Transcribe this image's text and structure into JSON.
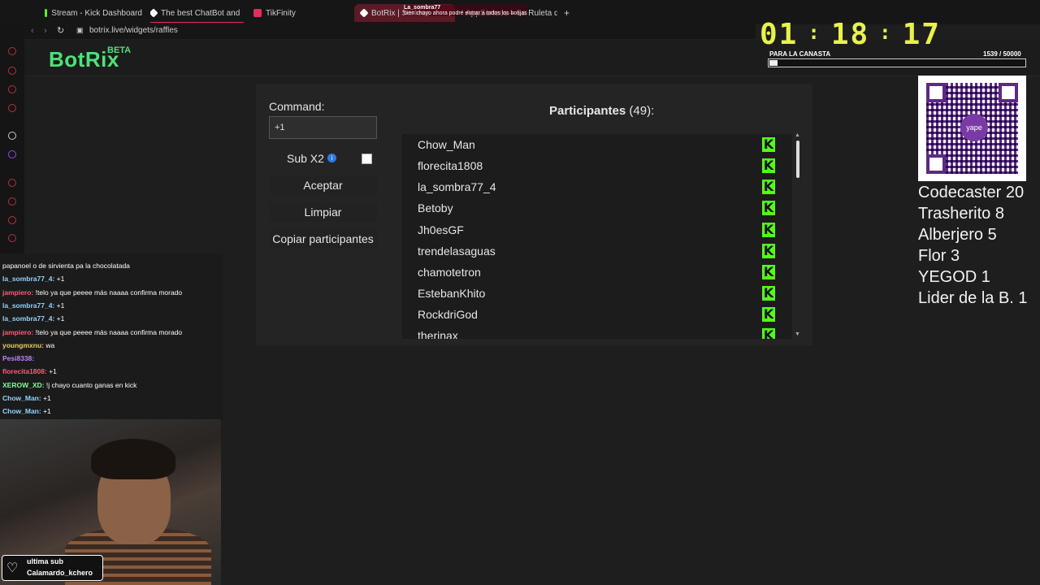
{
  "browser": {
    "tabs": [
      {
        "label": "Stream - Kick Dashboard",
        "color": "#53fc18"
      },
      {
        "label": "The best ChatBot and",
        "color": "#ffffff"
      },
      {
        "label": "TikFinity",
        "color": "#e0305a"
      },
      {
        "label": "BotRix | Sorteos",
        "color": "#e0305a"
      },
      {
        "label": "AppSorteos – La Ruleta d",
        "color": "#b048d8"
      }
    ],
    "new_tab_label": "+",
    "url": "botrix.live/widgets/raffles"
  },
  "overlay": {
    "chat_toast_user": "La_sombra77",
    "chat_toast_message": "bien chayo ahora podré entrar a todos los botijas"
  },
  "app": {
    "logo": "BotRix",
    "logo_badge": "BETA"
  },
  "raffle": {
    "command_label": "Command:",
    "command_value": "+1",
    "sub_label": "Sub X2",
    "info_icon": "i",
    "accept_label": "Aceptar",
    "clear_label": "Limpiar",
    "copy_label": "Copiar participantes",
    "participants_title": "Participantes",
    "participants_count": "(49):",
    "platform_icon": "K",
    "participants": [
      "Chow_Man",
      "florecita1808",
      "la_sombra77_4",
      "Betoby",
      "Jh0esGF",
      "trendelasaguas",
      "chamotetron",
      "EstebanKhito",
      "RockdriGod",
      "therinax"
    ]
  },
  "stream": {
    "timer": [
      "01",
      ":",
      "18",
      ":",
      "17"
    ],
    "goal_label": "PARA LA CANASTA",
    "goal_value": "1539  / 50000",
    "goal_progress": 0.0308,
    "qr_brand": "yape",
    "rankings": [
      "Codecaster 20",
      "Trasherito 8",
      "Alberjero 5",
      "Flor 3",
      "YEGOD 1",
      "Lider de la B. 1"
    ]
  },
  "chat": [
    {
      "user": "",
      "msg": "papanoel o de sirvienta pa la chocolatada",
      "color": "#ffffff"
    },
    {
      "user": "la_sombra77_4:",
      "msg": "+1",
      "color": "#8fd3ff"
    },
    {
      "user": "jampiero:",
      "msg": "!telo ya que peeee más naaaa confirma morado",
      "color": "#ff5a7a"
    },
    {
      "user": "la_sombra77_4:",
      "msg": "+1",
      "color": "#8fd3ff"
    },
    {
      "user": "la_sombra77_4:",
      "msg": "+1",
      "color": "#8fd3ff"
    },
    {
      "user": "jampiero:",
      "msg": "!telo ya que peeee más naaaa confirma morado",
      "color": "#ff5a7a"
    },
    {
      "user": "youngmxnu:",
      "msg": "wa",
      "color": "#e8d060"
    },
    {
      "user": "Pesi8338:",
      "msg": "",
      "color": "#c080ff"
    },
    {
      "user": "florecita1808:",
      "msg": "+1",
      "color": "#ff5a7a"
    },
    {
      "user": "XEROW_XD:",
      "msg": "!j chayo cuanto ganas en kick",
      "color": "#7fff9a"
    },
    {
      "user": "Chow_Man:",
      "msg": "+1",
      "color": "#8fd3ff"
    },
    {
      "user": "Chow_Man:",
      "msg": "+1",
      "color": "#8fd3ff"
    }
  ],
  "sub_alert": {
    "title": "ultima sub",
    "name": "Calamardo_kchero"
  }
}
